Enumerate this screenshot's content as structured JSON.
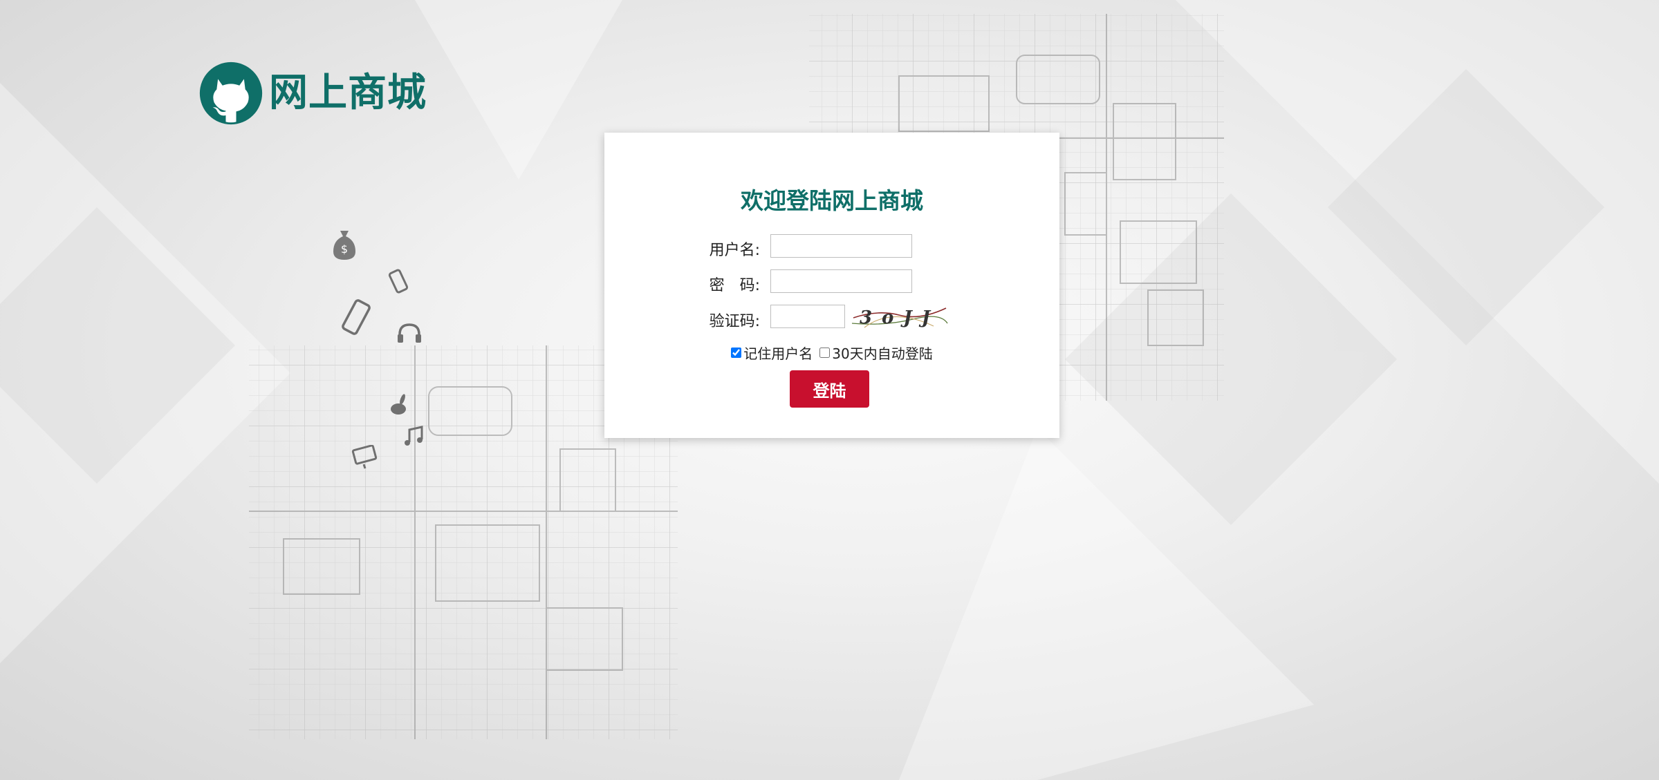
{
  "brand": {
    "name": "网上商城",
    "color": "#0f6f68"
  },
  "login": {
    "title": "欢迎登陆网上商城",
    "username_label": "用户名:",
    "password_label": "密　码:",
    "captcha_label": "验证码:",
    "username_value": "",
    "password_value": "",
    "captcha_value": "",
    "captcha_text": "3oJJ",
    "remember_label": "记住用户名",
    "remember_checked": true,
    "auto_login_label": "30天内自动登陆",
    "auto_login_checked": false,
    "submit_label": "登陆",
    "submit_color": "#c8102e"
  },
  "decorations": {
    "icons": [
      "money-bag-icon",
      "phone-icon",
      "smartphone-icon",
      "headphones-icon",
      "rabbit-icon",
      "music-note-icon",
      "monitor-icon"
    ]
  }
}
